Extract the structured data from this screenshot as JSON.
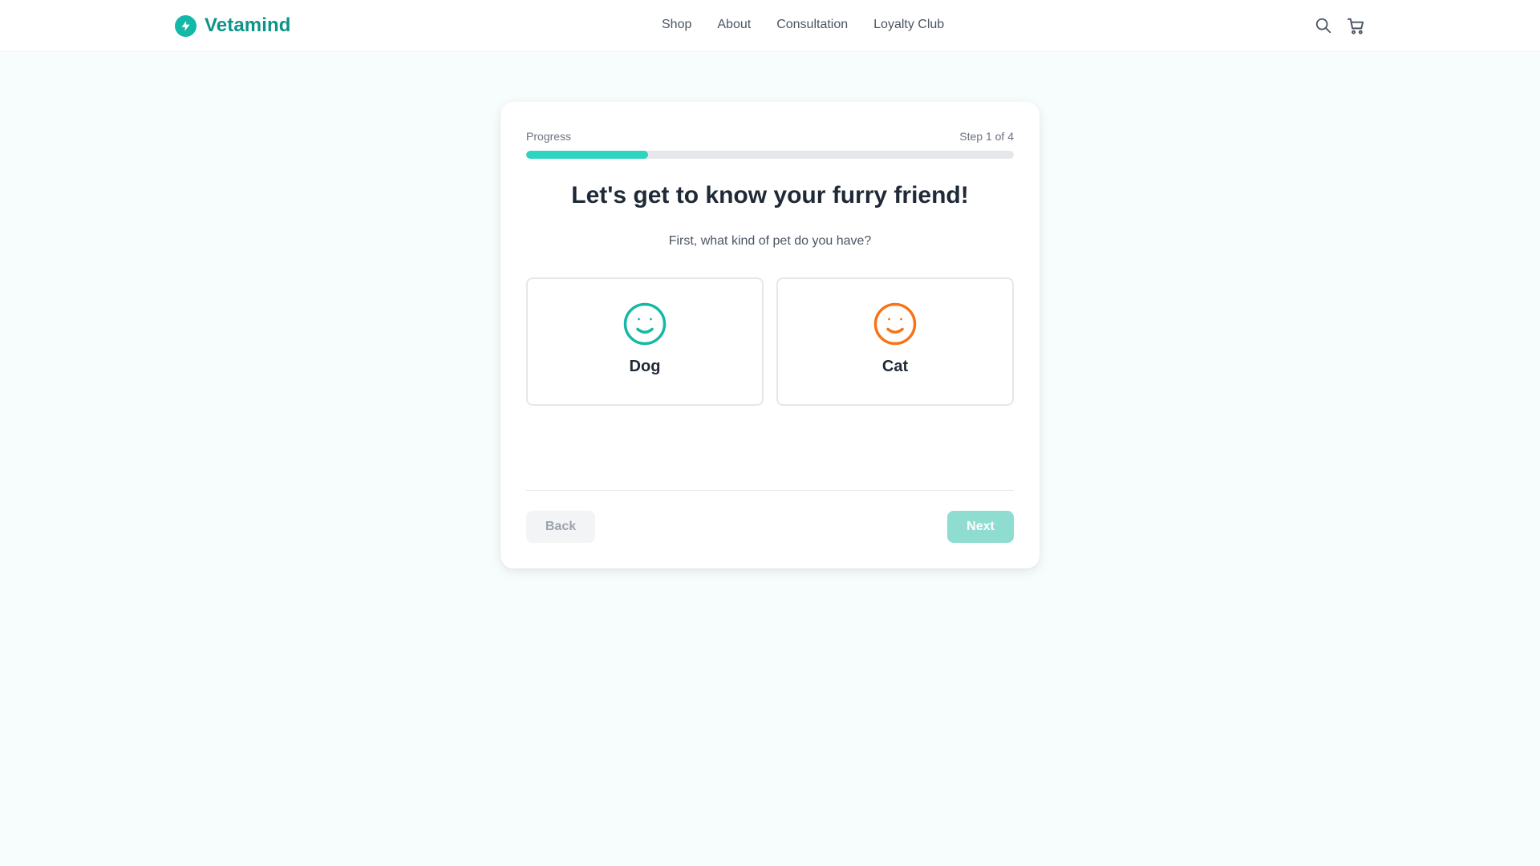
{
  "header": {
    "brand_name": "Vetamind",
    "nav": [
      {
        "label": "Shop"
      },
      {
        "label": "About"
      },
      {
        "label": "Consultation"
      },
      {
        "label": "Loyalty Club"
      }
    ],
    "icons": [
      "search-icon",
      "cart-icon"
    ]
  },
  "quiz": {
    "progress_label": "Progress",
    "step_text": "Step 1 of 4",
    "progress_fraction": 0.25,
    "title": "Let's get to know your furry friend!",
    "question": "First, what kind of pet do you have?",
    "options": [
      {
        "label": "Dog",
        "icon": "smiley-face-icon",
        "color": "#14b8a6"
      },
      {
        "label": "Cat",
        "icon": "smiley-face-icon",
        "color": "#f97316"
      }
    ],
    "back_label": "Back",
    "next_label": "Next"
  },
  "colors": {
    "brand": "#0d9488",
    "accent": "#2dd4bf",
    "dog_icon": "#14b8a6",
    "cat_icon": "#f97316",
    "background": "#f7fcfc"
  }
}
